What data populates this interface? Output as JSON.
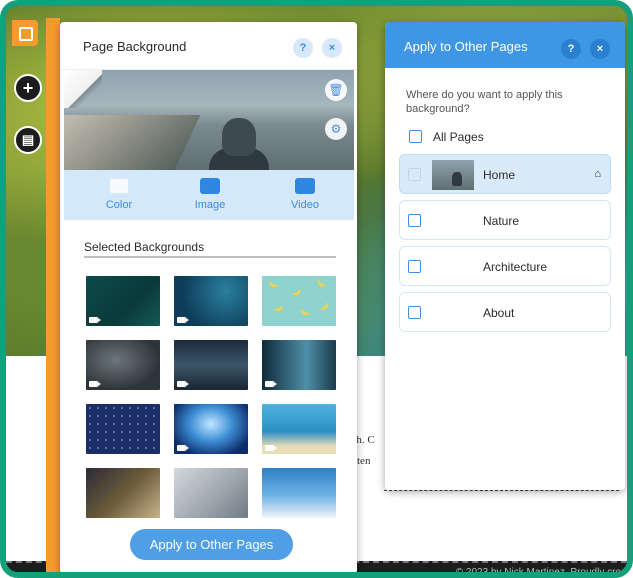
{
  "left_toolbar": {
    "add_icon": "plus-icon",
    "store_icon": "store-icon"
  },
  "page_background": {
    "title": "Page Background",
    "help_label": "?",
    "close_label": "×",
    "delete_icon": "trash-icon",
    "settings_icon": "gear-icon",
    "types": [
      {
        "label": "Color",
        "icon": "color-swatch-icon"
      },
      {
        "label": "Image",
        "icon": "image-icon"
      },
      {
        "label": "Video",
        "icon": "video-icon"
      }
    ],
    "selected_title": "Selected Backgrounds",
    "apply_button": "Apply to Other Pages"
  },
  "apply_panel": {
    "title": "Apply to Other Pages",
    "help_label": "?",
    "close_label": "×",
    "description": "Where do you want to apply this background?",
    "all_pages_label": "All Pages",
    "pages": [
      {
        "label": "Home",
        "selected": true,
        "is_home": true
      },
      {
        "label": "Nature",
        "selected": false
      },
      {
        "label": "Architecture",
        "selected": false
      },
      {
        "label": "About",
        "selected": false
      }
    ]
  },
  "site": {
    "text_fragment_1": "aph. C",
    "text_fragment_2": "onten",
    "text_fragment_3": "ea",
    "text_fragment_4": "n",
    "footer": "© 2023 by Nick Martinez. Proudly cre"
  },
  "colors": {
    "accent_blue": "#3e96e4",
    "sidebar_orange": "#f79a2e",
    "frame_green": "#14a07a"
  }
}
